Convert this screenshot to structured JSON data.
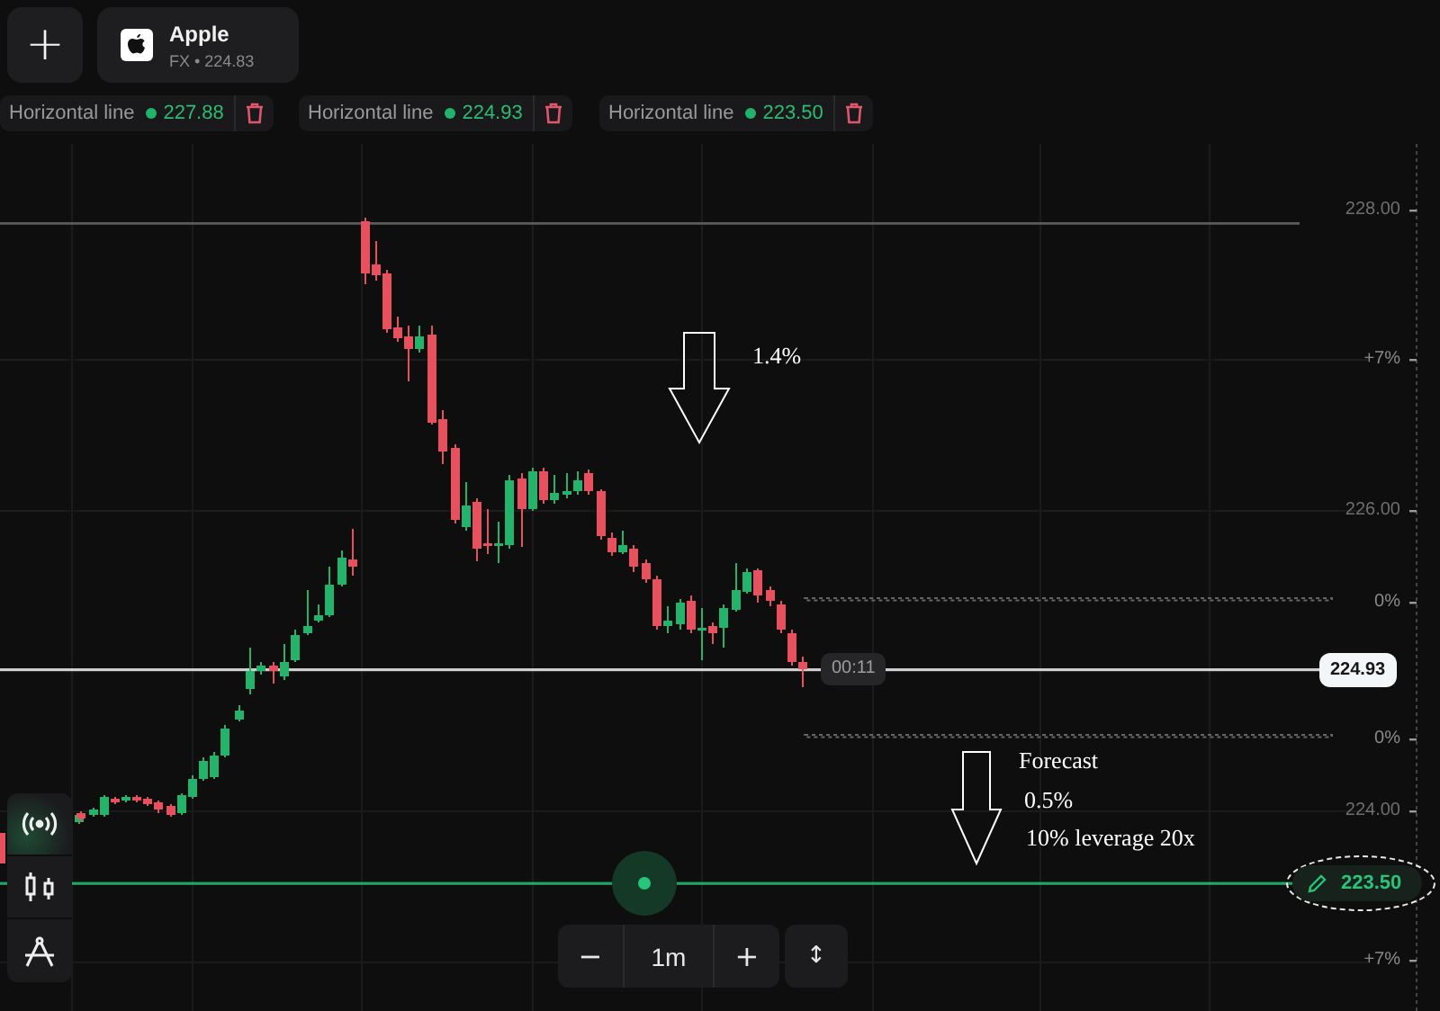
{
  "header": {
    "add_button": {
      "label": "+"
    },
    "asset": {
      "name": "Apple",
      "subtitle": "FX • 224.83"
    }
  },
  "drawings": [
    {
      "label": "Horizontal line",
      "value": "227.88"
    },
    {
      "label": "Horizontal line",
      "value": "224.93"
    },
    {
      "label": "Horizontal line",
      "value": "223.50"
    }
  ],
  "price_axis": [
    {
      "kind": "price",
      "label": "228.00"
    },
    {
      "kind": "percent",
      "label": "+7%"
    },
    {
      "kind": "price",
      "label": "226.00"
    },
    {
      "kind": "percent",
      "label": "0%"
    },
    {
      "kind": "percent",
      "label": "0%"
    },
    {
      "kind": "price",
      "label": "224.00"
    },
    {
      "kind": "percent",
      "label": "+7%"
    }
  ],
  "current_price": {
    "timer": "00:11",
    "price": "224.93"
  },
  "line_tag": {
    "price": "223.50"
  },
  "left_toolbar": [
    {
      "kind": "signal",
      "selected": true
    },
    {
      "kind": "candles",
      "selected": false
    },
    {
      "kind": "compass",
      "selected": false
    }
  ],
  "zoom_controls": {
    "minus": "−",
    "interval": "1m",
    "plus": "+",
    "fit": "↕"
  },
  "annotations": [
    {
      "text": "1.4%"
    },
    {
      "text": "Forecast"
    },
    {
      "text": "0.5%"
    },
    {
      "text": "10% leverage 20x"
    }
  ]
}
